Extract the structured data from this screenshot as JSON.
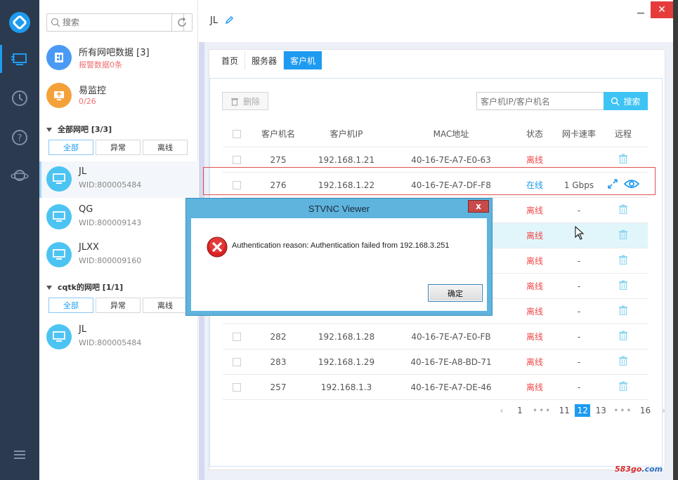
{
  "app": {
    "title": "JL",
    "close_glyph": "✕",
    "min_glyph": "—"
  },
  "sidebar": {
    "search_placeholder": "搜索",
    "summary": [
      {
        "title": "所有网吧数据 [3]",
        "sub": "报警数据0条",
        "color": "#4a9af5",
        "icon": "data-icon"
      },
      {
        "title": "易监控",
        "sub": "0/26",
        "color": "#f5a13a",
        "icon": "monitor-icon"
      }
    ],
    "groups": [
      {
        "title": "全部网吧 [3/3]",
        "filters": [
          "全部",
          "异常",
          "离线"
        ],
        "items": [
          {
            "name": "JL",
            "wid": "WID:800005484"
          },
          {
            "name": "QG",
            "wid": "WID:800009143"
          },
          {
            "name": "JLXX",
            "wid": "WID:800009160"
          }
        ]
      },
      {
        "title": "cqtk的网吧 [1/1]",
        "filters": [
          "全部",
          "异常",
          "离线"
        ],
        "items": [
          {
            "name": "JL",
            "wid": "WID:800005484"
          }
        ]
      }
    ]
  },
  "tabs": [
    "首页",
    "服务器",
    "客户机"
  ],
  "toolbar": {
    "delete_label": "删除",
    "search_placeholder": "客户机IP/客户机名",
    "search_label": "搜索"
  },
  "table": {
    "headers": [
      "客户机名",
      "客户机IP",
      "MAC地址",
      "状态",
      "网卡速率",
      "远程"
    ],
    "rows": [
      {
        "name": "275",
        "ip": "192.168.1.21",
        "mac": "40-16-7E-A7-E0-63",
        "state": "离线",
        "speed": "",
        "online": false
      },
      {
        "name": "276",
        "ip": "192.168.1.22",
        "mac": "40-16-7E-A7-DF-F8",
        "state": "在线",
        "speed": "1 Gbps",
        "online": true
      },
      {
        "name": "",
        "ip": "",
        "mac": "",
        "state": "离线",
        "speed": "-",
        "online": false
      },
      {
        "name": "",
        "ip": "",
        "mac": "",
        "state": "离线",
        "speed": "-",
        "online": false
      },
      {
        "name": "",
        "ip": "",
        "mac": "",
        "state": "离线",
        "speed": "-",
        "online": false
      },
      {
        "name": "",
        "ip": "",
        "mac": "",
        "state": "离线",
        "speed": "-",
        "online": false
      },
      {
        "name": "",
        "ip": "",
        "mac": "",
        "state": "离线",
        "speed": "-",
        "online": false
      },
      {
        "name": "282",
        "ip": "192.168.1.28",
        "mac": "40-16-7E-A7-E0-FB",
        "state": "离线",
        "speed": "-",
        "online": false
      },
      {
        "name": "283",
        "ip": "192.168.1.29",
        "mac": "40-16-7E-A8-BD-71",
        "state": "离线",
        "speed": "-",
        "online": false
      },
      {
        "name": "257",
        "ip": "192.168.1.3",
        "mac": "40-16-7E-A7-DE-46",
        "state": "离线",
        "speed": "-",
        "online": false
      }
    ]
  },
  "pagination": {
    "prev": "‹",
    "next": "›",
    "pages": [
      "1",
      "•••",
      "11",
      "12",
      "13",
      "•••",
      "16"
    ],
    "current": "12"
  },
  "dialog": {
    "title": "STVNC Viewer",
    "close": "x",
    "message": "Authentication reason: Authentication failed from 192.168.3.251",
    "ok": "确定"
  },
  "watermark": {
    "a": "583go",
    "b": ".com"
  },
  "colors": {
    "accent": "#1e9bf0",
    "offline": "#f04848",
    "rail": "#2c3a4f",
    "client": "#4cc4f2"
  }
}
